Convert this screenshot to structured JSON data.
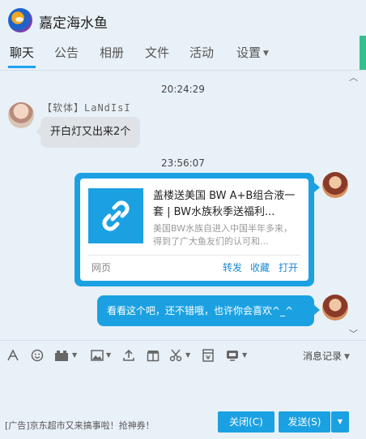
{
  "header": {
    "group_title": "嘉定海水鱼",
    "tabs": [
      {
        "label": "聊天",
        "active": true
      },
      {
        "label": "公告",
        "active": false
      },
      {
        "label": "相册",
        "active": false
      },
      {
        "label": "文件",
        "active": false
      },
      {
        "label": "活动",
        "active": false
      },
      {
        "label": "设置",
        "active": false,
        "has_dropdown": true
      }
    ],
    "accent_color": "#1da1f2"
  },
  "chat": {
    "messages": [
      {
        "type": "timestamp",
        "text": "20:24:29"
      },
      {
        "type": "incoming",
        "sender": "【软体】LaNdIsI",
        "text": "开白灯又出来2个",
        "avatar_icon": "user-avatar-icon"
      },
      {
        "type": "timestamp",
        "text": "23:56:07"
      },
      {
        "type": "outgoing-card",
        "title": "盖楼送美国 BW A+B组合液一套 | BW水族秋季送福利...",
        "description": "美国BW水族自进入中国半年多来，得到了广大鱼友们的认可和...",
        "source": "网页",
        "actions": [
          "转发",
          "收藏",
          "打开"
        ],
        "thumb_icon": "link-icon",
        "avatar_icon": "self-avatar-icon"
      },
      {
        "type": "outgoing",
        "text": "看看这个吧，还不错哦，也许你会喜欢^_^",
        "avatar_icon": "self-avatar-icon"
      }
    ],
    "bubble_color": "#1ba1e2"
  },
  "toolbar": {
    "icons": [
      "font-icon",
      "emoji-icon",
      "gift-icon",
      "image-icon",
      "upload-icon",
      "box-icon",
      "scissors-icon",
      "red-packet-icon",
      "screen-share-icon"
    ],
    "history_label": "消息记录"
  },
  "footer": {
    "ad_text": "[广告]京东超市又来搞事啦！抢神券！",
    "close_label": "关闭(C)",
    "send_label": "发送(S)"
  }
}
